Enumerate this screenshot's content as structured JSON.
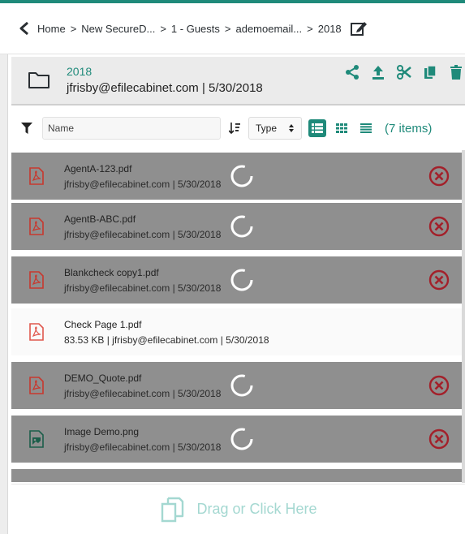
{
  "breadcrumb": {
    "items": [
      "Home",
      "New SecureD...",
      "1 - Guests",
      "ademoemail...",
      "2018"
    ],
    "separator": ">"
  },
  "folder": {
    "name": "2018",
    "subtitle": "jfrisby@efilecabinet.com | 5/30/2018",
    "actions": [
      "share-icon",
      "upload-icon",
      "cut-icon",
      "copy-icon",
      "delete-icon"
    ]
  },
  "toolbar": {
    "search_placeholder": "Name",
    "type_select": "Type",
    "item_count": "(7 items)"
  },
  "files": [
    {
      "name": "AgentA-123.pdf",
      "meta": "jfrisby@efilecabinet.com | 5/30/2018",
      "kind": "pdf",
      "status": "uploading"
    },
    {
      "name": "AgentB-ABC.pdf",
      "meta": "jfrisby@efilecabinet.com | 5/30/2018",
      "kind": "pdf",
      "status": "uploading"
    },
    {
      "name": "Blankcheck copy1.pdf",
      "meta": "jfrisby@efilecabinet.com | 5/30/2018",
      "kind": "pdf",
      "status": "uploading"
    },
    {
      "name": "Check Page 1.pdf",
      "meta": "83.53 KB | jfrisby@efilecabinet.com | 5/30/2018",
      "kind": "pdf",
      "status": "complete"
    },
    {
      "name": "DEMO_Quote.pdf",
      "meta": "jfrisby@efilecabinet.com | 5/30/2018",
      "kind": "pdf",
      "status": "uploading"
    },
    {
      "name": "Image Demo.png",
      "meta": "jfrisby@efilecabinet.com | 5/30/2018",
      "kind": "image",
      "status": "uploading"
    }
  ],
  "drop_zone": {
    "label": "Drag or Click Here"
  },
  "colors": {
    "accent": "#1f8a7a",
    "pending_row": "#8f8f8f",
    "cancel_red": "#a3202a",
    "pdf_red": "#c8382e",
    "drop_label": "#a4d8d1"
  }
}
